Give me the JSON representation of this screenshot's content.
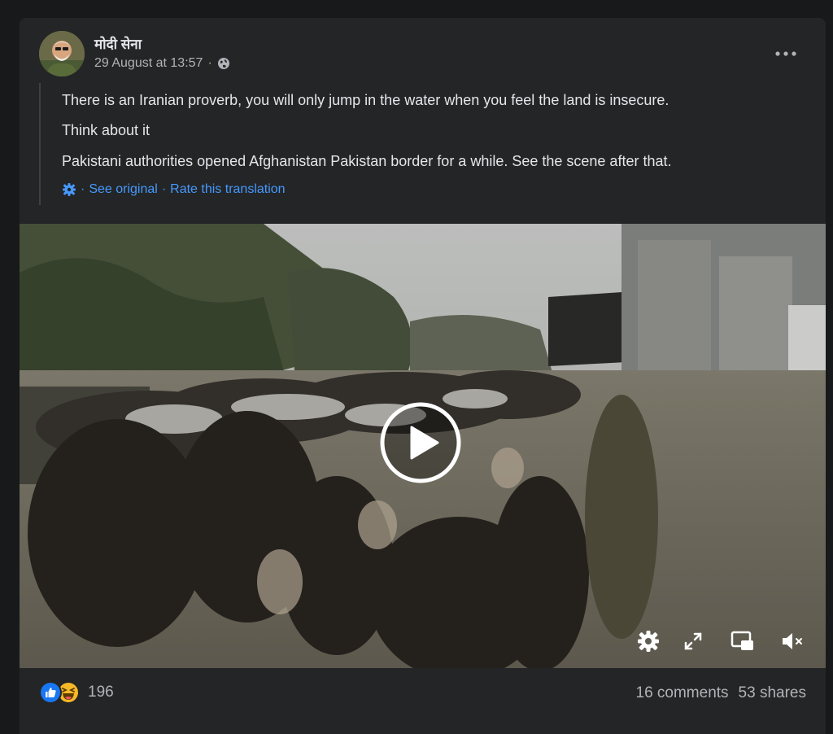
{
  "post": {
    "author": "मोदी सेना",
    "date": "29 August at 13:57",
    "date_sep": "·",
    "privacy_icon": "globe-icon",
    "more_icon": "more-dots-icon",
    "lines": [
      "There is an Iranian proverb, you will only jump in the water when you feel the land is insecure.",
      "Think about it",
      "Pakistani authorities opened Afghanistan Pakistan border for a while. See the scene after that."
    ],
    "translation": {
      "icon": "gear-icon",
      "sep": "·",
      "see_original": "See original",
      "rate": "Rate this translation"
    }
  },
  "video": {
    "play_icon": "play-icon",
    "controls": [
      "settings-icon",
      "fullscreen-icon",
      "picture-in-picture-icon",
      "mute-icon"
    ]
  },
  "footer": {
    "reaction_icons": [
      "like-reaction-icon",
      "haha-reaction-icon"
    ],
    "reaction_count": "196",
    "comments": "16 comments",
    "shares": "53 shares"
  },
  "colors": {
    "page_bg": "#18191a",
    "card_bg": "#242526",
    "primary_text": "#e4e6eb",
    "secondary_text": "#b0b3b8",
    "link": "#4599ff",
    "like_blue": "#1877f2",
    "haha_yellow": "#f7b928"
  }
}
